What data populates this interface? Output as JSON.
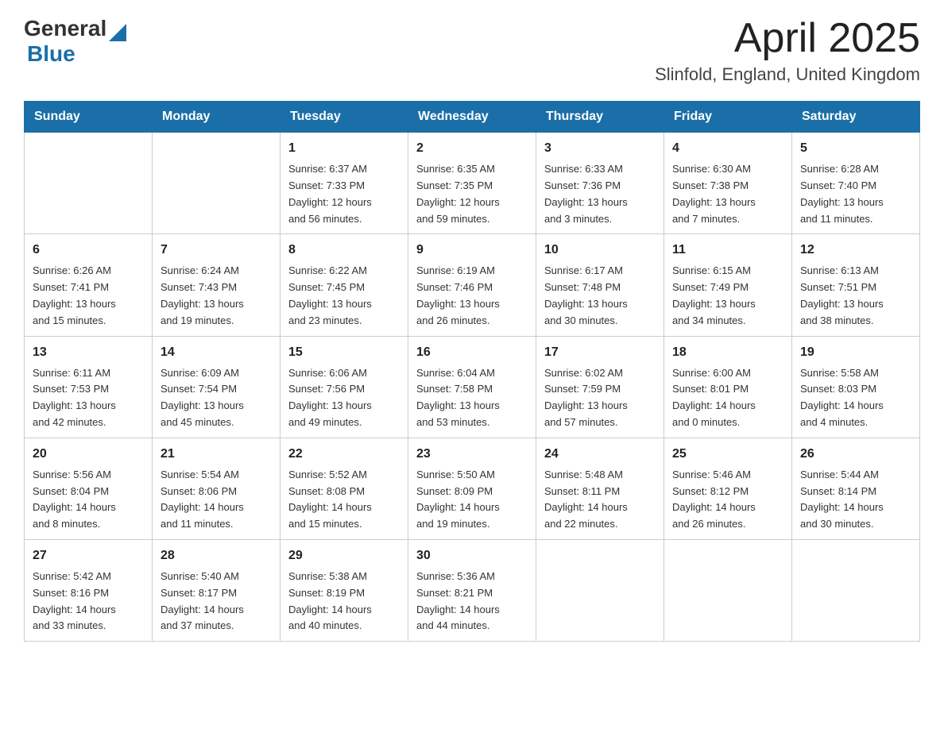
{
  "header": {
    "logo_general": "General",
    "logo_blue": "Blue",
    "month_title": "April 2025",
    "location": "Slinfold, England, United Kingdom"
  },
  "days_of_week": [
    "Sunday",
    "Monday",
    "Tuesday",
    "Wednesday",
    "Thursday",
    "Friday",
    "Saturday"
  ],
  "weeks": [
    [
      {
        "day": "",
        "info": ""
      },
      {
        "day": "",
        "info": ""
      },
      {
        "day": "1",
        "info": "Sunrise: 6:37 AM\nSunset: 7:33 PM\nDaylight: 12 hours\nand 56 minutes."
      },
      {
        "day": "2",
        "info": "Sunrise: 6:35 AM\nSunset: 7:35 PM\nDaylight: 12 hours\nand 59 minutes."
      },
      {
        "day": "3",
        "info": "Sunrise: 6:33 AM\nSunset: 7:36 PM\nDaylight: 13 hours\nand 3 minutes."
      },
      {
        "day": "4",
        "info": "Sunrise: 6:30 AM\nSunset: 7:38 PM\nDaylight: 13 hours\nand 7 minutes."
      },
      {
        "day": "5",
        "info": "Sunrise: 6:28 AM\nSunset: 7:40 PM\nDaylight: 13 hours\nand 11 minutes."
      }
    ],
    [
      {
        "day": "6",
        "info": "Sunrise: 6:26 AM\nSunset: 7:41 PM\nDaylight: 13 hours\nand 15 minutes."
      },
      {
        "day": "7",
        "info": "Sunrise: 6:24 AM\nSunset: 7:43 PM\nDaylight: 13 hours\nand 19 minutes."
      },
      {
        "day": "8",
        "info": "Sunrise: 6:22 AM\nSunset: 7:45 PM\nDaylight: 13 hours\nand 23 minutes."
      },
      {
        "day": "9",
        "info": "Sunrise: 6:19 AM\nSunset: 7:46 PM\nDaylight: 13 hours\nand 26 minutes."
      },
      {
        "day": "10",
        "info": "Sunrise: 6:17 AM\nSunset: 7:48 PM\nDaylight: 13 hours\nand 30 minutes."
      },
      {
        "day": "11",
        "info": "Sunrise: 6:15 AM\nSunset: 7:49 PM\nDaylight: 13 hours\nand 34 minutes."
      },
      {
        "day": "12",
        "info": "Sunrise: 6:13 AM\nSunset: 7:51 PM\nDaylight: 13 hours\nand 38 minutes."
      }
    ],
    [
      {
        "day": "13",
        "info": "Sunrise: 6:11 AM\nSunset: 7:53 PM\nDaylight: 13 hours\nand 42 minutes."
      },
      {
        "day": "14",
        "info": "Sunrise: 6:09 AM\nSunset: 7:54 PM\nDaylight: 13 hours\nand 45 minutes."
      },
      {
        "day": "15",
        "info": "Sunrise: 6:06 AM\nSunset: 7:56 PM\nDaylight: 13 hours\nand 49 minutes."
      },
      {
        "day": "16",
        "info": "Sunrise: 6:04 AM\nSunset: 7:58 PM\nDaylight: 13 hours\nand 53 minutes."
      },
      {
        "day": "17",
        "info": "Sunrise: 6:02 AM\nSunset: 7:59 PM\nDaylight: 13 hours\nand 57 minutes."
      },
      {
        "day": "18",
        "info": "Sunrise: 6:00 AM\nSunset: 8:01 PM\nDaylight: 14 hours\nand 0 minutes."
      },
      {
        "day": "19",
        "info": "Sunrise: 5:58 AM\nSunset: 8:03 PM\nDaylight: 14 hours\nand 4 minutes."
      }
    ],
    [
      {
        "day": "20",
        "info": "Sunrise: 5:56 AM\nSunset: 8:04 PM\nDaylight: 14 hours\nand 8 minutes."
      },
      {
        "day": "21",
        "info": "Sunrise: 5:54 AM\nSunset: 8:06 PM\nDaylight: 14 hours\nand 11 minutes."
      },
      {
        "day": "22",
        "info": "Sunrise: 5:52 AM\nSunset: 8:08 PM\nDaylight: 14 hours\nand 15 minutes."
      },
      {
        "day": "23",
        "info": "Sunrise: 5:50 AM\nSunset: 8:09 PM\nDaylight: 14 hours\nand 19 minutes."
      },
      {
        "day": "24",
        "info": "Sunrise: 5:48 AM\nSunset: 8:11 PM\nDaylight: 14 hours\nand 22 minutes."
      },
      {
        "day": "25",
        "info": "Sunrise: 5:46 AM\nSunset: 8:12 PM\nDaylight: 14 hours\nand 26 minutes."
      },
      {
        "day": "26",
        "info": "Sunrise: 5:44 AM\nSunset: 8:14 PM\nDaylight: 14 hours\nand 30 minutes."
      }
    ],
    [
      {
        "day": "27",
        "info": "Sunrise: 5:42 AM\nSunset: 8:16 PM\nDaylight: 14 hours\nand 33 minutes."
      },
      {
        "day": "28",
        "info": "Sunrise: 5:40 AM\nSunset: 8:17 PM\nDaylight: 14 hours\nand 37 minutes."
      },
      {
        "day": "29",
        "info": "Sunrise: 5:38 AM\nSunset: 8:19 PM\nDaylight: 14 hours\nand 40 minutes."
      },
      {
        "day": "30",
        "info": "Sunrise: 5:36 AM\nSunset: 8:21 PM\nDaylight: 14 hours\nand 44 minutes."
      },
      {
        "day": "",
        "info": ""
      },
      {
        "day": "",
        "info": ""
      },
      {
        "day": "",
        "info": ""
      }
    ]
  ]
}
